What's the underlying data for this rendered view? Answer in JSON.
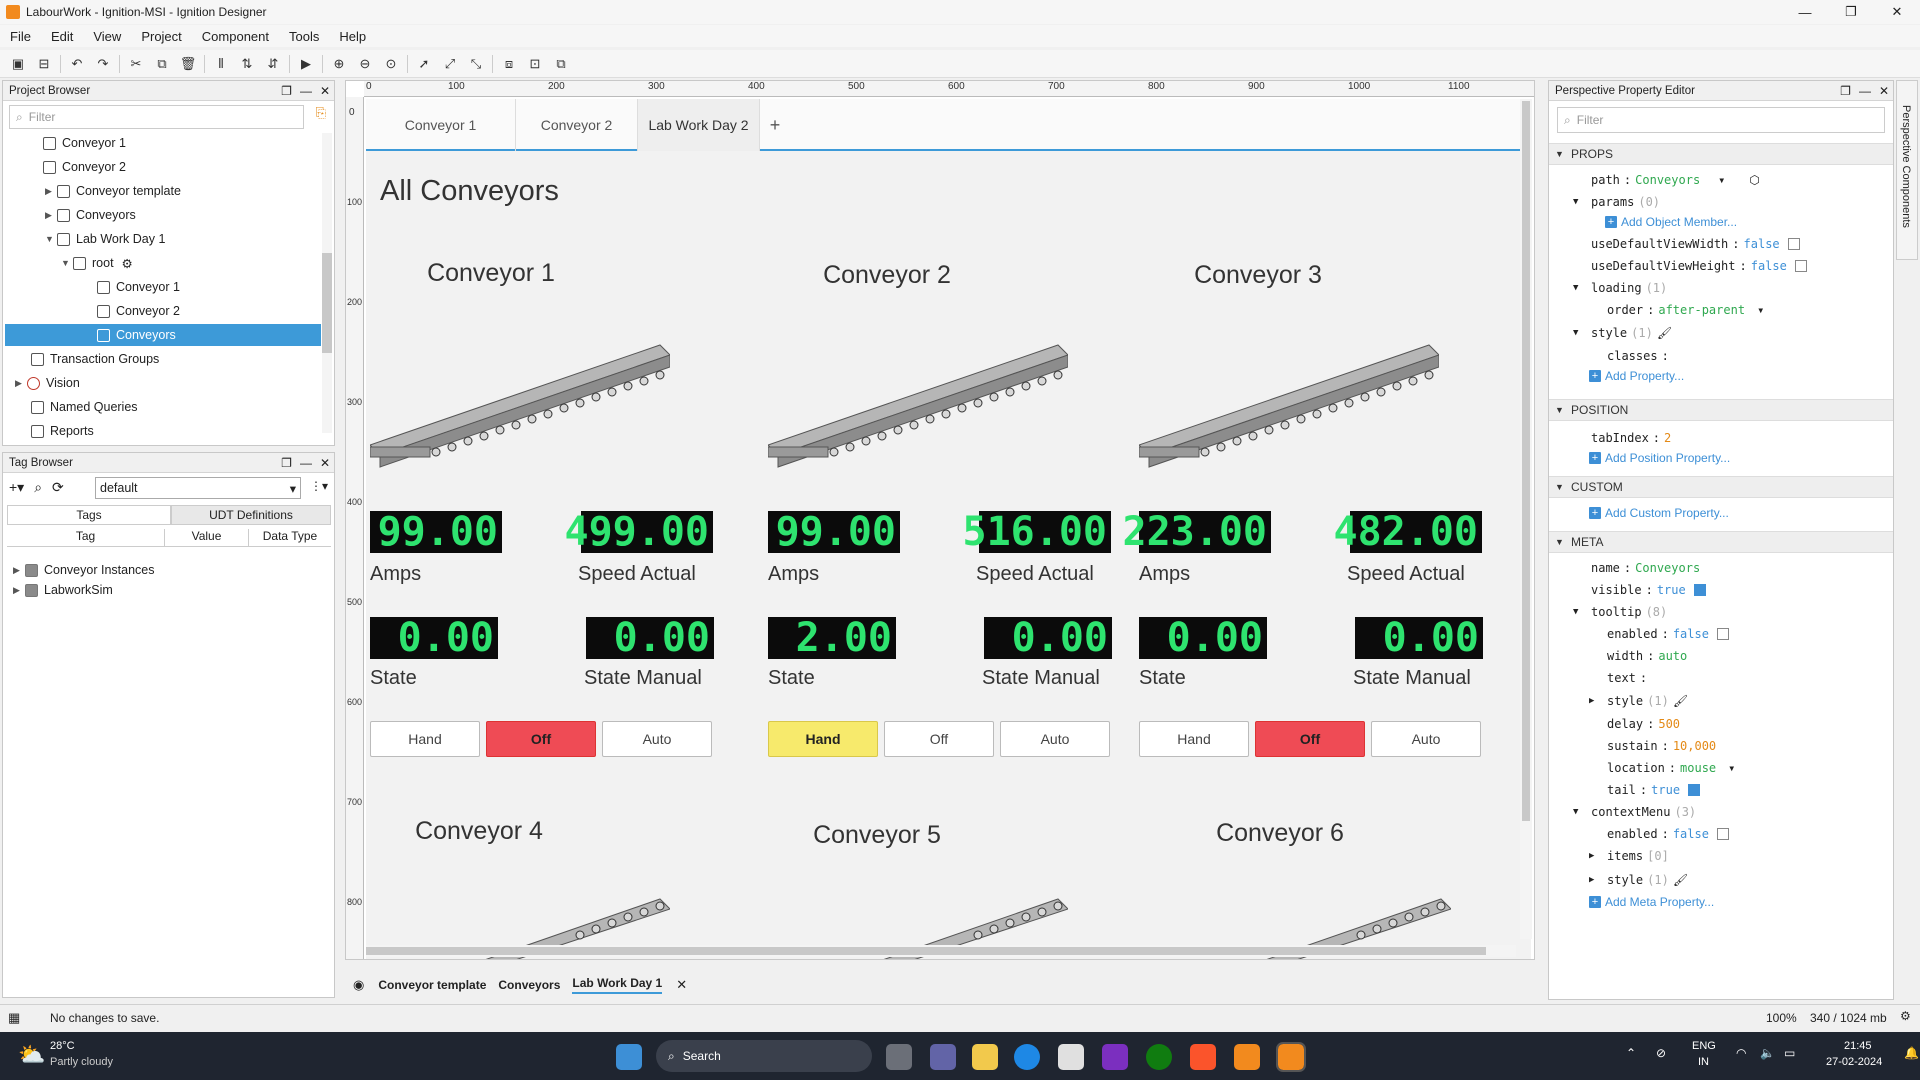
{
  "window": {
    "title": "LabourWork - Ignition-MSI - Ignition Designer",
    "min": "—",
    "max": "❐",
    "close": "✕"
  },
  "menu": [
    "File",
    "Edit",
    "View",
    "Project",
    "Component",
    "Tools",
    "Help"
  ],
  "project_browser": {
    "title": "Project Browser",
    "filter_placeholder": "Filter",
    "items": [
      "Conveyor 1",
      "Conveyor 2",
      "Conveyor template",
      "Conveyors",
      "Lab Work Day 1",
      "root",
      "Conveyor 1",
      "Conveyor 2",
      "Conveyors",
      "Transaction Groups",
      "Vision",
      "Named Queries",
      "Reports"
    ]
  },
  "tag_browser": {
    "title": "Tag Browser",
    "provider": "default",
    "tabs": [
      "Tags",
      "UDT Definitions"
    ],
    "columns": [
      "Tag",
      "Value",
      "Data Type"
    ],
    "rows": [
      "Conveyor Instances",
      "LabworkSim"
    ]
  },
  "ruler": {
    "top": [
      "0",
      "100",
      "200",
      "300",
      "400",
      "500",
      "600",
      "700",
      "800",
      "900",
      "1000",
      "1100"
    ],
    "left": [
      "0",
      "100",
      "200",
      "300",
      "400",
      "500",
      "600",
      "700",
      "800"
    ]
  },
  "view": {
    "tabs": [
      "Conveyor 1",
      "Conveyor 2",
      "Lab Work Day 2"
    ],
    "add_tab": "+",
    "title": "All Conveyors",
    "conveyors": [
      {
        "name": "Conveyor 1",
        "amps": "99.00",
        "speed": "499.00",
        "state": "0.00",
        "state_manual": "0.00",
        "mode": "Off"
      },
      {
        "name": "Conveyor 2",
        "amps": "99.00",
        "speed": "516.00",
        "state": "2.00",
        "state_manual": "0.00",
        "mode": "Hand"
      },
      {
        "name": "Conveyor 3",
        "amps": "223.00",
        "speed": "482.00",
        "state": "0.00",
        "state_manual": "0.00",
        "mode": "Off"
      }
    ],
    "labels": {
      "amps": "Amps",
      "speed": "Speed Actual",
      "state": "State",
      "state_manual": "State Manual"
    },
    "buttons": [
      "Hand",
      "Off",
      "Auto"
    ],
    "lower_titles": [
      "Conveyor 4",
      "Conveyor 5",
      "Conveyor 6"
    ]
  },
  "bottom_tabs": [
    "Conveyor template",
    "Conveyors",
    "Lab Work Day 1"
  ],
  "property_editor": {
    "title": "Perspective Property Editor",
    "filter_placeholder": "Filter",
    "side_label": "Perspective Components",
    "sections": [
      "PROPS",
      "POSITION",
      "CUSTOM",
      "META"
    ],
    "rows": {
      "path": "path",
      "path_val": "Conveyors",
      "params": "params",
      "params_count": "(0)",
      "add_object": "Add Object Member...",
      "udvw": "useDefaultViewWidth",
      "udvh": "useDefaultViewHeight",
      "false": "false",
      "loading": "loading",
      "loading_count": "(1)",
      "order": "order",
      "order_val": "after-parent",
      "style": "style",
      "style_count": "(1)",
      "classes": "classes",
      "add_property": "Add Property...",
      "tabindex": "tabIndex",
      "tabindex_val": "2",
      "add_position": "Add Position Property...",
      "add_custom": "Add Custom Property...",
      "name": "name",
      "name_val": "Conveyors",
      "visible": "visible",
      "true": "true",
      "tooltip": "tooltip",
      "tooltip_count": "(8)",
      "enabled": "enabled",
      "width": "width",
      "width_val": "auto",
      "text": "text",
      "delay": "delay",
      "delay_val": "500",
      "sustain": "sustain",
      "sustain_val": "10,000",
      "location": "location",
      "location_val": "mouse",
      "tail": "tail",
      "contextmenu": "contextMenu",
      "contextmenu_count": "(3)",
      "items": "items",
      "items_count": "[0]",
      "add_meta": "Add Meta Property..."
    }
  },
  "status": {
    "message": "No changes to save.",
    "zoom": "100%",
    "memory": "340 / 1024 mb"
  },
  "taskbar": {
    "temp": "28°C",
    "weather": "Partly cloudy",
    "search": "Search",
    "lang": "ENG",
    "region": "IN",
    "time": "21:45",
    "date": "27-02-2024"
  }
}
